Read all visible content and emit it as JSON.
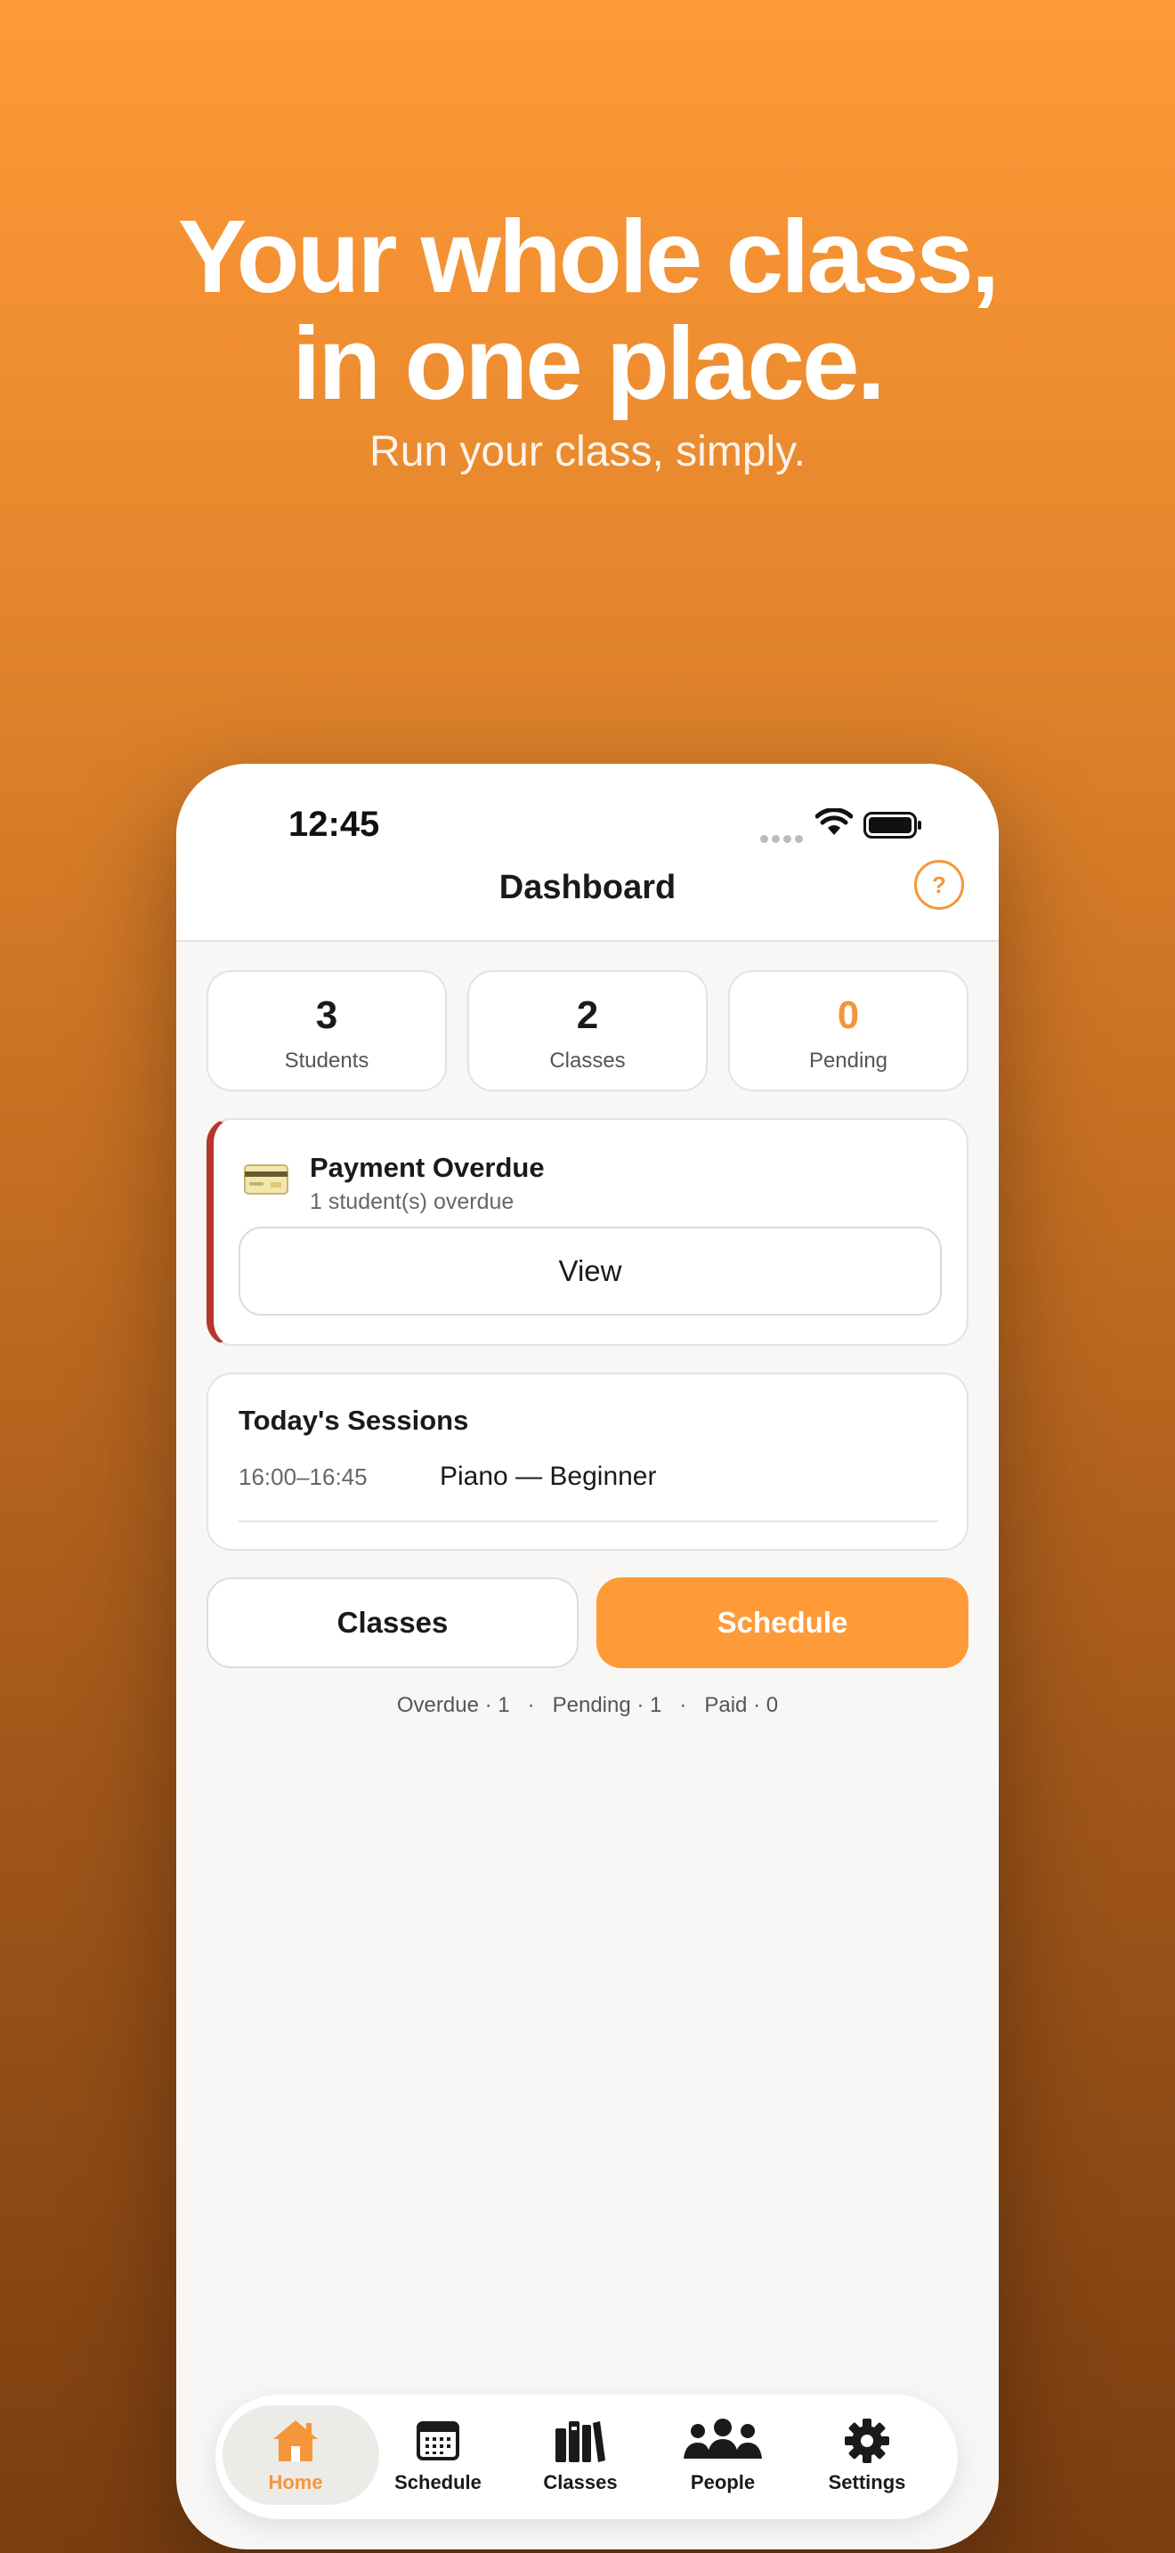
{
  "hero": {
    "title_line1": "Your whole class,",
    "title_line2": "in one place.",
    "subtitle": "Run your class, simply."
  },
  "status_bar": {
    "time": "12:45"
  },
  "header": {
    "title": "Dashboard",
    "help_label": "?"
  },
  "stats": [
    {
      "value": "3",
      "label": "Students"
    },
    {
      "value": "2",
      "label": "Classes"
    },
    {
      "value": "0",
      "label": "Pending"
    }
  ],
  "alert": {
    "icon": "credit-card-icon",
    "title": "Payment Overdue",
    "subtitle": "1 student(s) overdue",
    "button_label": "View"
  },
  "sessions": {
    "title": "Today's Sessions",
    "items": [
      {
        "time": "16:00–16:45",
        "name": "Piano — Beginner"
      }
    ]
  },
  "actions": {
    "classes_label": "Classes",
    "schedule_label": "Schedule"
  },
  "summary": "Overdue · 1   ·   Pending · 1   ·   Paid · 0",
  "tabs": [
    {
      "label": "Home",
      "icon": "home-icon",
      "active": true
    },
    {
      "label": "Schedule",
      "icon": "calendar-icon",
      "active": false
    },
    {
      "label": "Classes",
      "icon": "books-icon",
      "active": false
    },
    {
      "label": "People",
      "icon": "people-icon",
      "active": false
    },
    {
      "label": "Settings",
      "icon": "gear-icon",
      "active": false
    }
  ],
  "colors": {
    "accent": "#FF9A38",
    "alert_bar": "#B5372E",
    "background_top": "#FF9A38",
    "background_bottom": "#7A3E10"
  }
}
